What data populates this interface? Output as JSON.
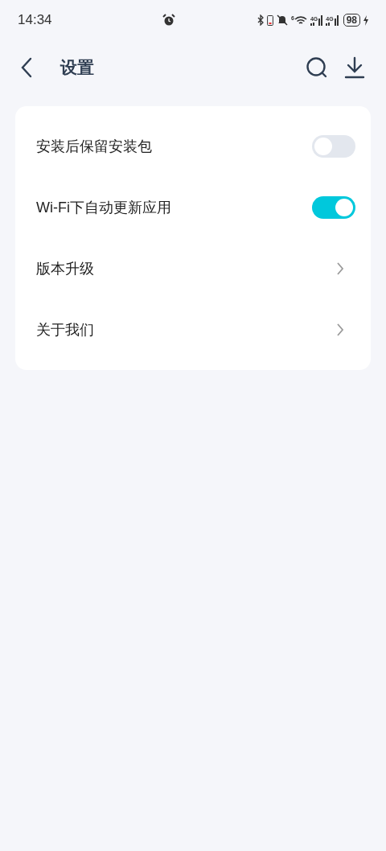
{
  "status_bar": {
    "time": "14:34",
    "wifi_badge": "6",
    "networks": [
      "4G",
      "4G"
    ],
    "battery": "98"
  },
  "header": {
    "title": "设置"
  },
  "settings": [
    {
      "kind": "toggle",
      "label": "安装后保留安装包",
      "on": false
    },
    {
      "kind": "toggle",
      "label": "Wi-Fi下自动更新应用",
      "on": true
    },
    {
      "kind": "link",
      "label": "版本升级"
    },
    {
      "kind": "link",
      "label": "关于我们"
    }
  ]
}
